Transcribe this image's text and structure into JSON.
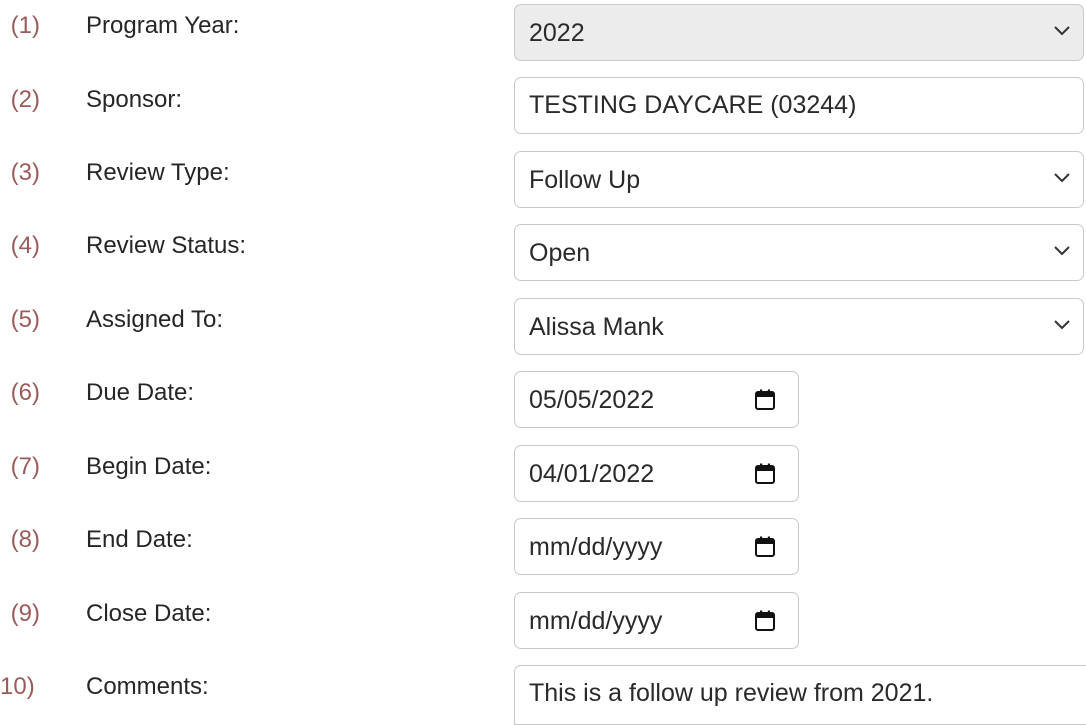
{
  "form": {
    "fields": [
      {
        "number": "(1)",
        "label": "Program Year:",
        "type": "select",
        "value": "2022",
        "disabled": true
      },
      {
        "number": "(2)",
        "label": "Sponsor:",
        "type": "text",
        "value": "TESTING DAYCARE (03244)"
      },
      {
        "number": "(3)",
        "label": "Review Type:",
        "type": "select",
        "value": "Follow Up"
      },
      {
        "number": "(4)",
        "label": "Review Status:",
        "type": "select",
        "value": "Open"
      },
      {
        "number": "(5)",
        "label": "Assigned To:",
        "type": "select",
        "value": "Alissa Mank"
      },
      {
        "number": "(6)",
        "label": "Due Date:",
        "type": "date",
        "value": "05/05/2022"
      },
      {
        "number": "(7)",
        "label": "Begin Date:",
        "type": "date",
        "value": "04/01/2022"
      },
      {
        "number": "(8)",
        "label": "End Date:",
        "type": "date",
        "value": "mm/dd/yyyy",
        "is_placeholder": true
      },
      {
        "number": "(9)",
        "label": "Close Date:",
        "type": "date",
        "value": "mm/dd/yyyy",
        "is_placeholder": true
      },
      {
        "number": "(10)",
        "label": "Comments:",
        "type": "textarea",
        "value": "This is a follow up review from 2021."
      }
    ]
  },
  "icons": {
    "select_arrow": "chevron-down-icon",
    "date_picker": "calendar-icon"
  },
  "colors": {
    "number": "#9b5b5b",
    "label": "#262626",
    "border": "#c9c9c9",
    "disabled_bg": "#ececec"
  }
}
